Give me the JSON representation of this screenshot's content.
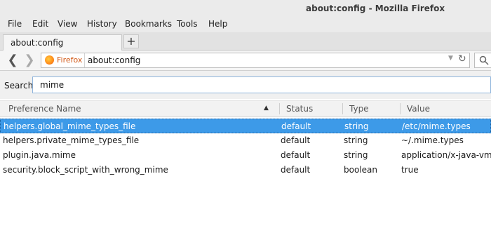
{
  "window": {
    "title": "about:config - Mozilla Firefox"
  },
  "menu": [
    "File",
    "Edit",
    "View",
    "History",
    "Bookmarks",
    "Tools",
    "Help"
  ],
  "tab": {
    "label": "about:config",
    "new_tab": "+"
  },
  "nav": {
    "back": "❮",
    "forward": "❯",
    "identity_label": "Firefox",
    "url": "about:config",
    "dropdown": "▼",
    "reload": "↻"
  },
  "search": {
    "label": "Search:",
    "value": "mime"
  },
  "columns": {
    "name": "Preference Name",
    "status": "Status",
    "type": "Type",
    "value": "Value"
  },
  "sort_indicator": "▲",
  "rows": [
    {
      "name": "helpers.global_mime_types_file",
      "status": "default",
      "type": "string",
      "value": "/etc/mime.types",
      "selected": true
    },
    {
      "name": "helpers.private_mime_types_file",
      "status": "default",
      "type": "string",
      "value": "~/.mime.types",
      "selected": false
    },
    {
      "name": "plugin.java.mime",
      "status": "default",
      "type": "string",
      "value": "application/x-java-vm",
      "selected": false
    },
    {
      "name": "security.block_script_with_wrong_mime",
      "status": "default",
      "type": "boolean",
      "value": "true",
      "selected": false
    }
  ],
  "colors": {
    "selection": "#3d9ae8",
    "identity": "#d25a18"
  }
}
